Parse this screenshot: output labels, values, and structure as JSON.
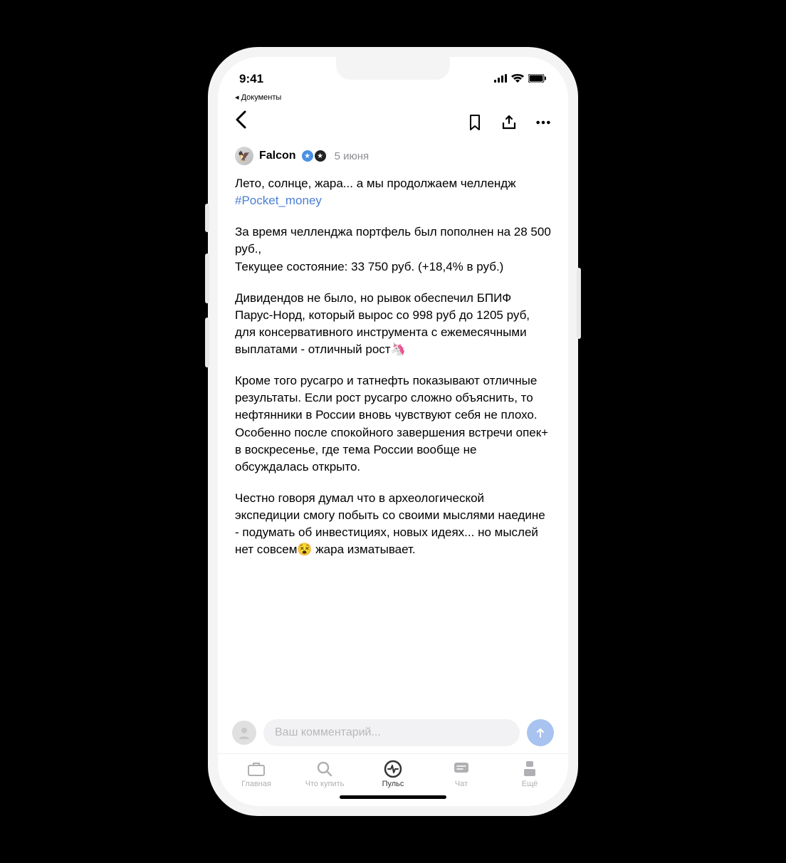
{
  "status": {
    "time": "9:41",
    "back_label": "◂ Документы"
  },
  "post": {
    "author": "Falcon",
    "date": "5 июня",
    "intro_prefix": "Лето, солнце, жара... а мы продолжаем челлендж ",
    "hashtag": "#Pocket_money",
    "p2": "За время челленджа портфель был пополнен на 28 500 руб.,\nТекущее состояние: 33 750 руб. (+18,4% в руб.)",
    "p3": "Дивидендов не было, но рывок обеспечил БПИФ Парус-Норд, который вырос со 998 руб до 1205 руб, для консервативного инструмента с ежемесячными  выплатами - отличный рост🦄",
    "p4": "Кроме того русагро и татнефть показывают отличные результаты. Если рост русагро сложно объяснить, то нефтянники в России вновь чувствуют себя не плохо. Особенно после спокойного завершения встречи опек+ в воскресенье,  где тема России вообще не обсуждалась открыто.",
    "p5": "Честно говоря думал что в археологической экспедиции смогу побыть со своими мыслями наедине - подумать об инвестициях, новых идеях... но мыслей нет совсем😵 жара изматывает."
  },
  "comment": {
    "placeholder": "Ваш комментарий..."
  },
  "nav": {
    "items": [
      {
        "label": "Главная"
      },
      {
        "label": "Что купить"
      },
      {
        "label": "Пульс"
      },
      {
        "label": "Чат"
      },
      {
        "label": "Ещё"
      }
    ]
  }
}
